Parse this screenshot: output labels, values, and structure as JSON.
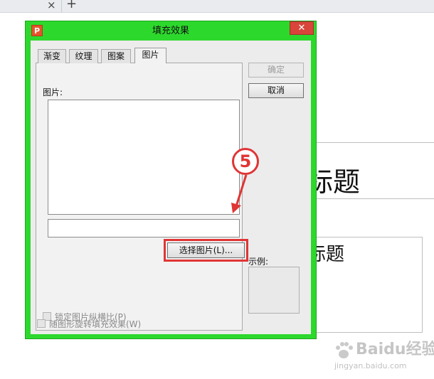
{
  "browser": {
    "close_glyph": "×",
    "add_glyph": "+"
  },
  "slide": {
    "title": "标题",
    "subtitle": "标题"
  },
  "dialog": {
    "title": "填充效果",
    "app_icon": "P",
    "close_glyph": "✕",
    "tabs": [
      {
        "label": "渐变",
        "active": false
      },
      {
        "label": "纹理",
        "active": false
      },
      {
        "label": "图案",
        "active": false
      },
      {
        "label": "图片",
        "active": true
      }
    ],
    "picture_label": "图片:",
    "picture_path": "",
    "select_picture_button": "选择图片(L)...",
    "lock_ratio_label": "锁定图片纵横比(P)",
    "rotate_with_shape_label": "随图形旋转填充效果(W)",
    "ok_button": "确定",
    "cancel_button": "取消",
    "preview_label": "示例:"
  },
  "annotation": {
    "step": "5",
    "color": "#e03535"
  },
  "watermark": {
    "text": "Baidu经验",
    "url": "jingyan.baidu.com"
  },
  "colors": {
    "dialog_frame": "#2dd82d",
    "close_button": "#d9453a",
    "highlight": "#e03535"
  }
}
